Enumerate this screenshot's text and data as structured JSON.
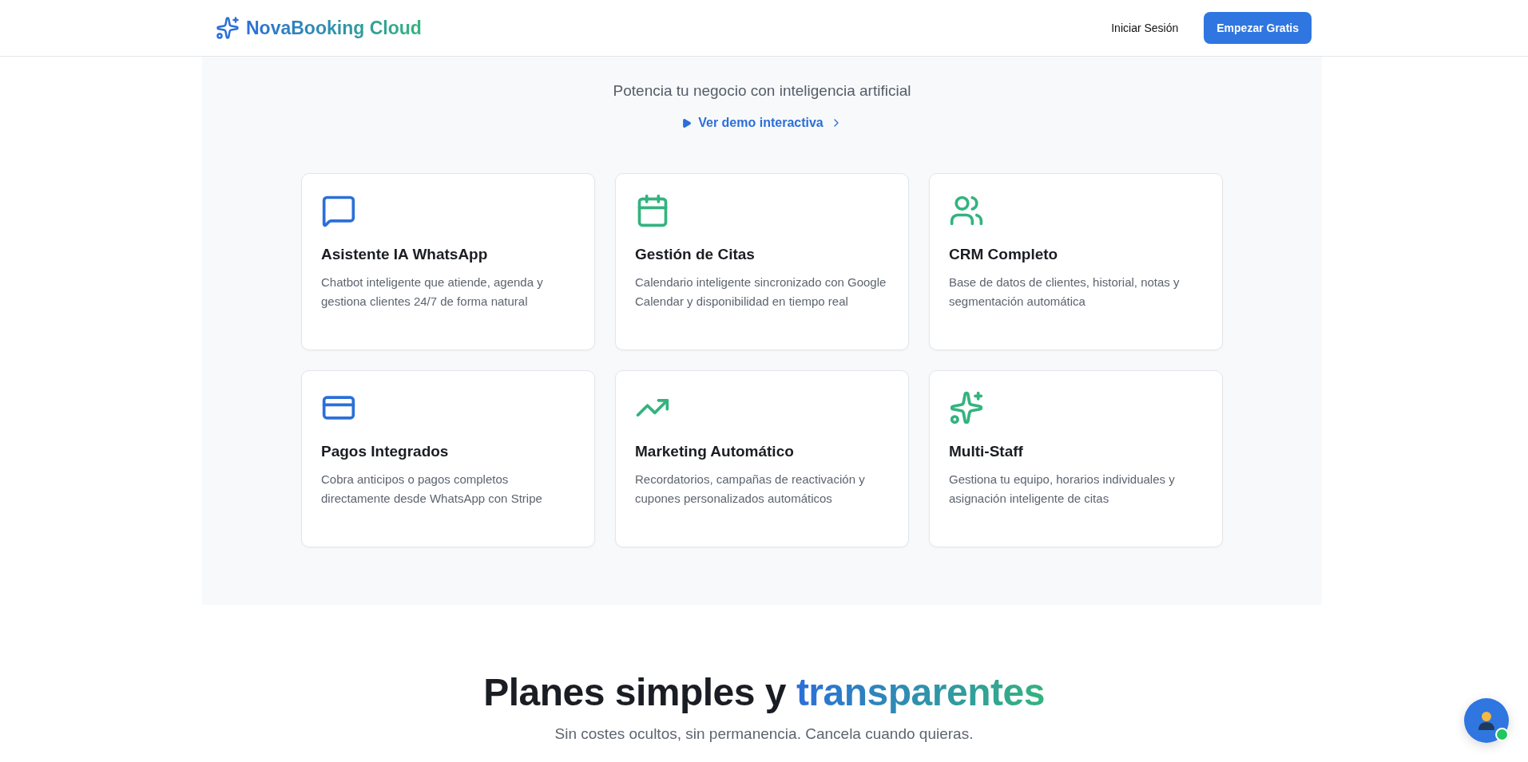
{
  "header": {
    "brand": {
      "first": "NovaBooking",
      "second": "Cloud"
    },
    "login": "Iniciar Sesión",
    "cta": "Empezar Gratis"
  },
  "features": {
    "subtitle": "Potencia tu negocio con inteligencia artificial",
    "demo_link": "Ver demo interactiva",
    "cards": [
      {
        "title": "Asistente IA WhatsApp",
        "text": "Chatbot inteligente que atiende, agenda y gestiona clientes 24/7 de forma natural"
      },
      {
        "title": "Gestión de Citas",
        "text": "Calendario inteligente sincronizado con Google Calendar y disponibilidad en tiempo real"
      },
      {
        "title": "CRM Completo",
        "text": "Base de datos de clientes, historial, notas y segmentación automática"
      },
      {
        "title": "Pagos Integrados",
        "text": "Cobra anticipos o pagos completos directamente desde WhatsApp con Stripe"
      },
      {
        "title": "Marketing Automático",
        "text": "Recordatorios, campañas de reactivación y cupones personalizados automáticos"
      },
      {
        "title": "Multi-Staff",
        "text": "Gestiona tu equipo, horarios individuales y asignación inteligente de citas"
      }
    ]
  },
  "pricing": {
    "heading": "Planes simples y",
    "highlight": "transparentes",
    "subtitle": "Sin costes ocultos, sin permanencia. Cancela cuando quieras."
  },
  "chat_widget": {
    "online": true
  }
}
